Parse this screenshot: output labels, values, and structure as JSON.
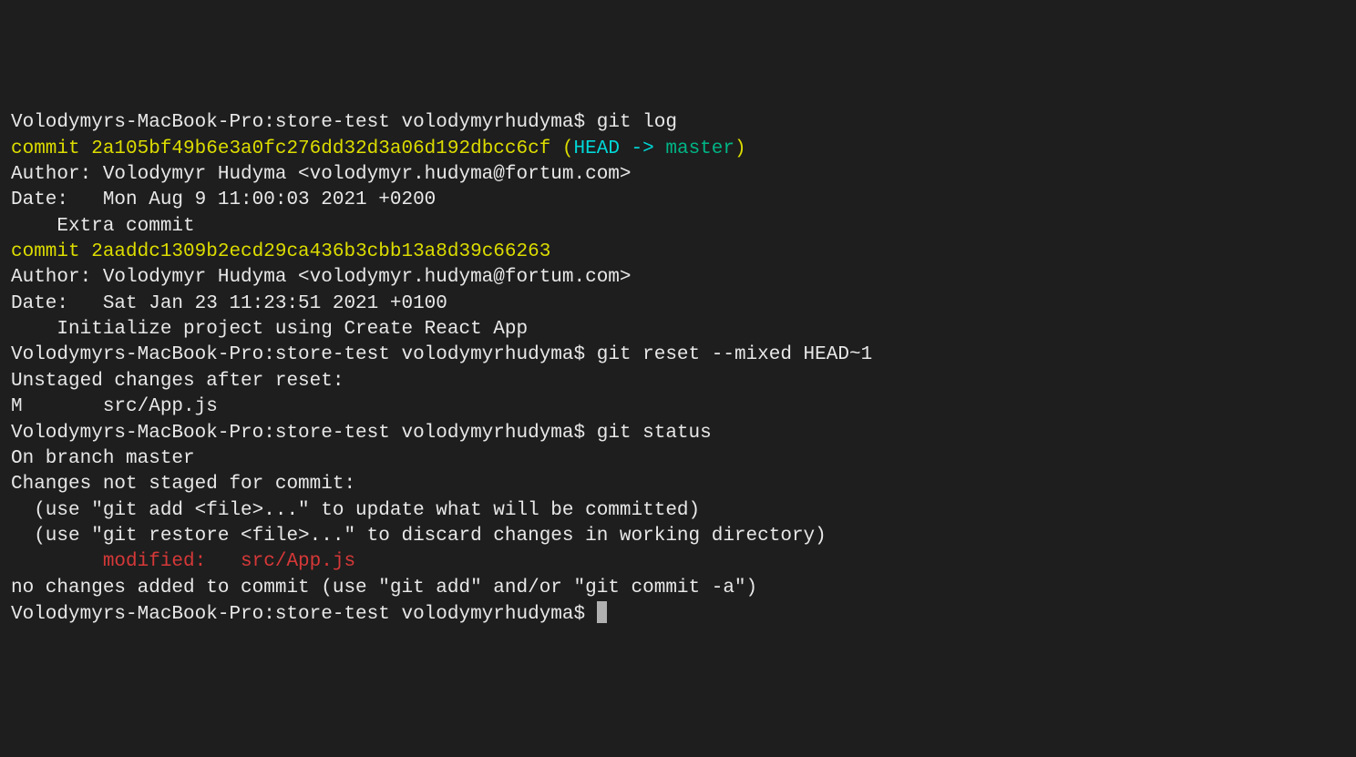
{
  "prompt": "Volodymyrs-MacBook-Pro:store-test volodymyrhudyma$ ",
  "commands": {
    "gitlog": "git log",
    "gitreset": "git reset --mixed HEAD~1",
    "gitstatus": "git status"
  },
  "commit1": {
    "label": "commit ",
    "hash": "2a105bf49b6e3a0fc276dd32d3a06d192dbcc6cf",
    "paren_open": " (",
    "head": "HEAD -> ",
    "branch": "master",
    "paren_close": ")",
    "author": "Author: Volodymyr Hudyma <volodymyr.hudyma@fortum.com>",
    "date": "Date:   Mon Aug 9 11:00:03 2021 +0200",
    "message": "    Extra commit"
  },
  "commit2": {
    "label": "commit ",
    "hash": "2aaddc1309b2ecd29ca436b3cbb13a8d39c66263",
    "author": "Author: Volodymyr Hudyma <volodymyr.hudyma@fortum.com>",
    "date": "Date:   Sat Jan 23 11:23:51 2021 +0100",
    "message": "    Initialize project using Create React App"
  },
  "reset_output": {
    "line1": "Unstaged changes after reset:",
    "line2": "M       src/App.js"
  },
  "status_output": {
    "branch": "On branch master",
    "changes_header": "Changes not staged for commit:",
    "hint1": "  (use \"git add <file>...\" to update what will be committed)",
    "hint2": "  (use \"git restore <file>...\" to discard changes in working directory)",
    "modified": "        modified:   src/App.js",
    "no_changes": "no changes added to commit (use \"git add\" and/or \"git commit -a\")"
  },
  "blank": ""
}
